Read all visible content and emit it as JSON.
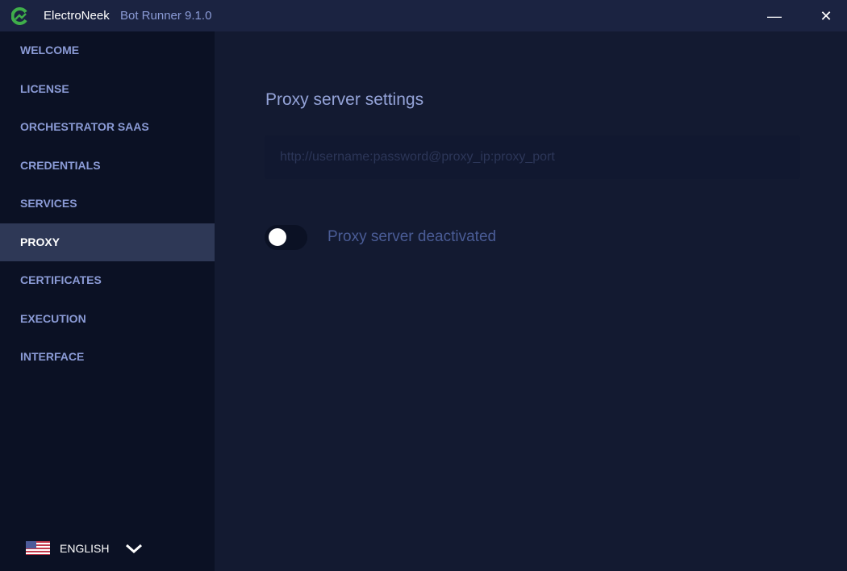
{
  "titlebar": {
    "app_name": "ElectroNeek",
    "version": "Bot Runner 9.1.0",
    "minimize": "—",
    "close": "✕"
  },
  "sidebar": {
    "items": [
      {
        "label": "WELCOME"
      },
      {
        "label": "LICENSE"
      },
      {
        "label": "ORCHESTRATOR SAAS"
      },
      {
        "label": "CREDENTIALS"
      },
      {
        "label": "SERVICES"
      },
      {
        "label": "PROXY",
        "active": true
      },
      {
        "label": "CERTIFICATES"
      },
      {
        "label": "EXECUTION"
      },
      {
        "label": "INTERFACE"
      }
    ],
    "language": "ENGLISH"
  },
  "main": {
    "title": "Proxy server settings",
    "proxy_input": {
      "value": "",
      "placeholder": "http://username:password@proxy_ip:proxy_port"
    },
    "toggle": {
      "on": false,
      "label": "Proxy server deactivated"
    }
  },
  "colors": {
    "accent": "#3fae4a",
    "active_bg": "#2e3856"
  }
}
